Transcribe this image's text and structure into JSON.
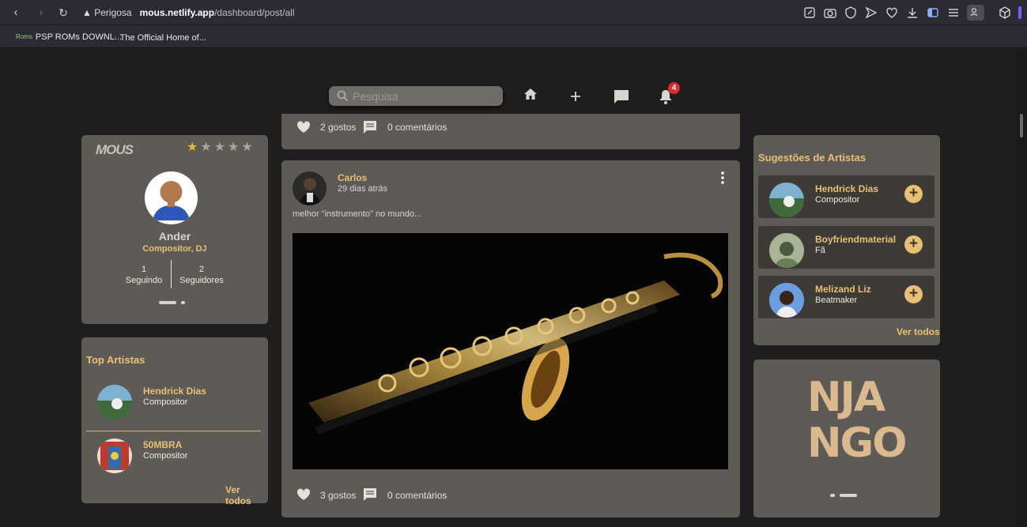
{
  "browser": {
    "security_label": "Perigosa",
    "url_host": "mous.netlify.app",
    "url_path": "/dashboard/post/all",
    "bookmarks": [
      {
        "favicon": "Roms",
        "label": "PSP ROMs DOWNL..."
      },
      {
        "favicon": "·",
        "label": "The Official Home of..."
      }
    ]
  },
  "topbar": {
    "search_placeholder": "Pesquisa",
    "notification_count": "4"
  },
  "profile": {
    "logo_text": "MOUS",
    "rating_stars": 5,
    "name": "Ander",
    "role": "Compositor, DJ",
    "following_count": "1",
    "following_label": "Seguindo",
    "followers_count": "2",
    "followers_label": "Seguidores"
  },
  "top_artists": {
    "title": "Top Artistas",
    "items": [
      {
        "name": "Hendrick Dias",
        "role": "Compositor"
      },
      {
        "name": "50MBRA",
        "role": "Compositor"
      }
    ],
    "see_all": "Ver todos"
  },
  "feed": {
    "prev_post": {
      "likes": "2 gostos",
      "comments": "0 comentários"
    },
    "post": {
      "author": "Carlos",
      "time": "29 dias atrás",
      "text": "melhor \"instrumento\" no mundo...",
      "likes": "3 gostos",
      "comments": "0 comentários"
    }
  },
  "suggestions": {
    "title": "Sugestões de Artistas",
    "items": [
      {
        "name": "Hendrick Dias",
        "role": "Compositor"
      },
      {
        "name": "Boyfriendmaterial",
        "role": "Fã"
      },
      {
        "name": "Melizand Liz",
        "role": "Beatmaker"
      }
    ],
    "see_all": "Ver todos"
  },
  "promo": {
    "logo_line1": "NJA",
    "logo_line2": "NGO"
  },
  "colors": {
    "accent": "#e8c074",
    "card": "#5e5a55",
    "background": "#1e1e1e"
  }
}
